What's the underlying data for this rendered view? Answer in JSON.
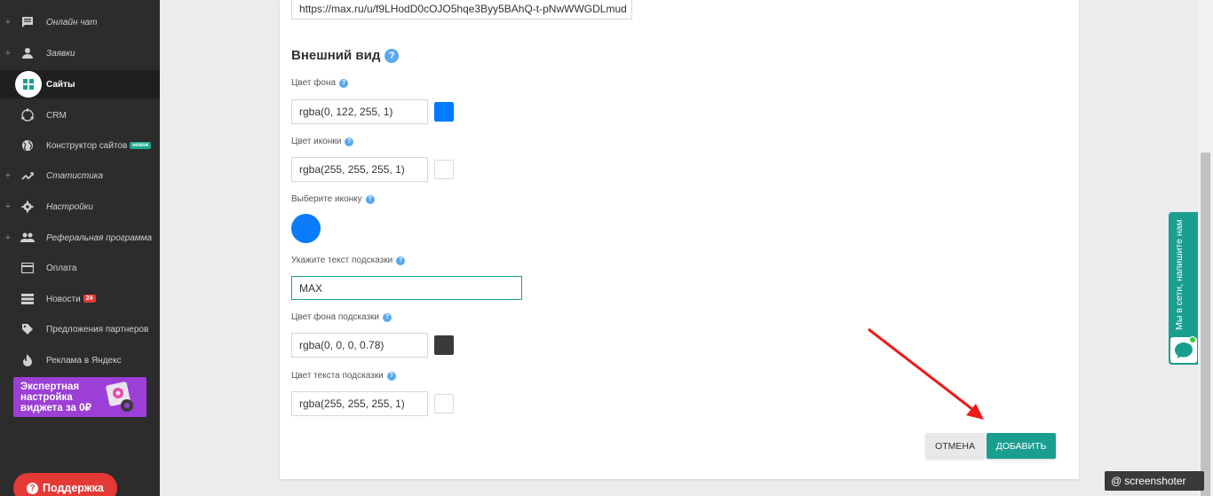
{
  "sidebar": {
    "items": [
      {
        "label": "Онлайн чат",
        "has_plus": true,
        "italic": true,
        "icon": "chat-icon"
      },
      {
        "label": "Заявки",
        "has_plus": true,
        "italic": true,
        "icon": "person-icon"
      },
      {
        "label": "Сайты",
        "has_plus": false,
        "italic": false,
        "icon": "sites-icon",
        "active": true
      },
      {
        "label": "CRM",
        "has_plus": false,
        "italic": false,
        "icon": "crm-icon"
      },
      {
        "label": "Конструктор сайтов",
        "has_plus": false,
        "italic": false,
        "icon": "globe-icon",
        "badge": "новое"
      },
      {
        "label": "Статистика",
        "has_plus": true,
        "italic": true,
        "icon": "trend-icon"
      },
      {
        "label": "Настройки",
        "has_plus": true,
        "italic": true,
        "icon": "gear-icon"
      },
      {
        "label": "Реферальная программа",
        "has_plus": true,
        "italic": true,
        "icon": "group-icon"
      },
      {
        "label": "Оплата",
        "has_plus": false,
        "italic": false,
        "icon": "card-icon"
      },
      {
        "label": "Новости",
        "has_plus": false,
        "italic": false,
        "icon": "list-icon",
        "count": "24"
      },
      {
        "label": "Предложения партнеров",
        "has_plus": false,
        "italic": false,
        "icon": "tag-icon"
      },
      {
        "label": "Реклама в Яндекс",
        "has_plus": false,
        "italic": false,
        "icon": "fire-icon"
      }
    ],
    "plus_symbol": "+",
    "promo_text": "Экспертная настройка виджета за 0₽",
    "support_label": "Поддержка",
    "support_q": "?"
  },
  "form": {
    "url_value": "https://max.ru/u/f9LHodD0cOJO5hqe3Byy5BAhQ-t-pNwWWGDLmud",
    "section_title": "Внешний вид",
    "help_symbol": "?",
    "bg_color_label": "Цвет фона",
    "bg_color_value": "rgba(0, 122, 255, 1)",
    "icon_color_label": "Цвет иконки",
    "icon_color_value": "rgba(255, 255, 255, 1)",
    "choose_icon_label": "Выберите иконку",
    "hint_text_label": "Укажите текст подсказки",
    "hint_text_value": "MAX",
    "hint_bg_label": "Цвет фона подсказки",
    "hint_bg_value": "rgba(0, 0, 0, 0.78)",
    "hint_text_color_label": "Цвет текста подсказки",
    "hint_text_color_value": "rgba(255, 255, 255, 1)",
    "cancel_label": "ОТМЕНА",
    "add_label": "ДОБАВИТЬ"
  },
  "colors": {
    "accent": "#1a9e8f",
    "blue_swatch": "#007aff",
    "dark_swatch": "#3a3a3a",
    "white_swatch": "#ffffff"
  },
  "widget": {
    "label": "Мы в сети, напишите нам"
  },
  "watermark": {
    "label": "screenshoter",
    "at": "@"
  }
}
